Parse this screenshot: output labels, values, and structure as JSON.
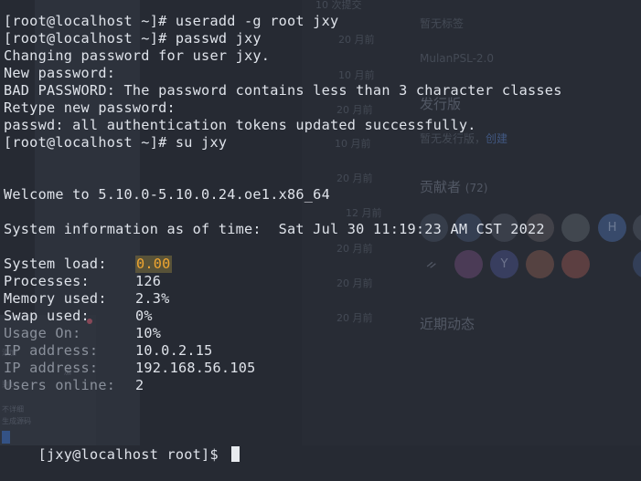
{
  "terminal": {
    "lines": {
      "l1": "[root@localhost ~]# useradd -g root jxy",
      "l2": "[root@localhost ~]# passwd jxy",
      "l3": "Changing password for user jxy.",
      "l4": "New password:",
      "l5": "BAD PASSWORD: The password contains less than 3 character classes",
      "l6": "Retype new password:",
      "l7": "passwd: all authentication tokens updated successfully.",
      "l8": "[root@localhost ~]# su jxy",
      "l9": "Welcome to 5.10.0-5.10.0.24.oe1.x86_64",
      "l10": "System information as of time:  Sat Jul 30 11:19:23 AM CST 2022"
    },
    "sysinfo": {
      "system_load_label": "System load:",
      "system_load_value": "0.00",
      "processes_label": "Processes:",
      "processes_value": "126",
      "memory_label": "Memory used:",
      "memory_value": "2.3%",
      "swap_label": "Swap used:",
      "swap_value": "0%",
      "usage_label": "Usage On:",
      "usage_value": "10%",
      "ip1_label": "IP address:",
      "ip1_value": "10.0.2.15",
      "ip2_label": "IP address:",
      "ip2_value": "192.168.56.105",
      "users_label": "Users online:",
      "users_value": "2"
    },
    "prompt": "[jxy@localhost root]$ "
  },
  "background": {
    "left_top": "10 次提交",
    "dates": [
      "20 月前",
      "10 月前",
      "20 月前",
      "10 月前",
      "20 月前",
      "12 月前",
      "20 月前",
      "20 月前",
      "20 月前"
    ],
    "right": {
      "label1": "暂无标签",
      "license": "MulanPSL-2.0",
      "release_title": "发行版",
      "release_text": "暂无发行版，",
      "release_link": "创建",
      "contributors_title": "贡献者",
      "contributors_count": "(72)",
      "recent_title": "近期动态"
    },
    "avatars_row1": [
      "",
      "",
      "",
      "",
      "",
      "H",
      ""
    ],
    "avatars_row2": [
      "",
      "Y",
      "",
      "",
      ""
    ],
    "left_tiny": [
      "添加",
      "加",
      "不详细",
      "生成源码",
      "到1"
    ]
  },
  "colors": {
    "background": "#262a33",
    "text": "#dfe3ea",
    "load_highlight": "#f0a630"
  }
}
